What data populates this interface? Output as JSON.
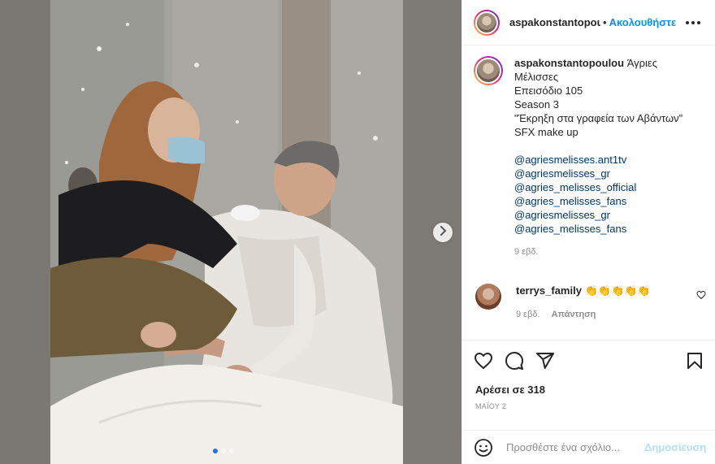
{
  "post": {
    "username": "aspakonstantopoulou",
    "header_username": "aspakonstantopou",
    "separator": "•",
    "follow_label": "Ακολουθήστε",
    "caption_lines": [
      "Άγριες",
      "Μέλισσες",
      "Επεισόδιο 105",
      "Season 3",
      "\"Έκρηξη στα γραφεία των Αβάντων\"",
      "SFX make up"
    ],
    "mentions": [
      "@agriesmelisses.ant1tv",
      "@agriesmelisses_gr",
      "@agries_melisses_official",
      "@agries_melisses_fans",
      "@agriesmelisses_gr",
      "@agries_melisses_fans"
    ],
    "caption_time": "9 εβδ.",
    "likes": "Αρέσει σε 318",
    "date": "ΜΑΪΟΥ 2"
  },
  "comment": {
    "username": "terrys_family",
    "text": "👏👏👏👏👏",
    "time": "9 εβδ.",
    "reply_label": "Απάντηση"
  },
  "composer": {
    "placeholder": "Προσθέστε ένα σχόλιο...",
    "post_label": "Δημοσίευση"
  },
  "carousel": {
    "slide_count": 3,
    "active_index": 0
  },
  "icons": {
    "like": "heart-icon",
    "comment": "comment-icon",
    "share": "share-icon",
    "save": "bookmark-icon",
    "emoji": "emoji-icon",
    "next": "chevron-right-icon",
    "more": "more-icon"
  },
  "colors": {
    "link_blue": "#0095f6",
    "mention_blue": "#00376b",
    "muted_text": "#8e8e8e",
    "post_disabled": "#b2dffc"
  }
}
